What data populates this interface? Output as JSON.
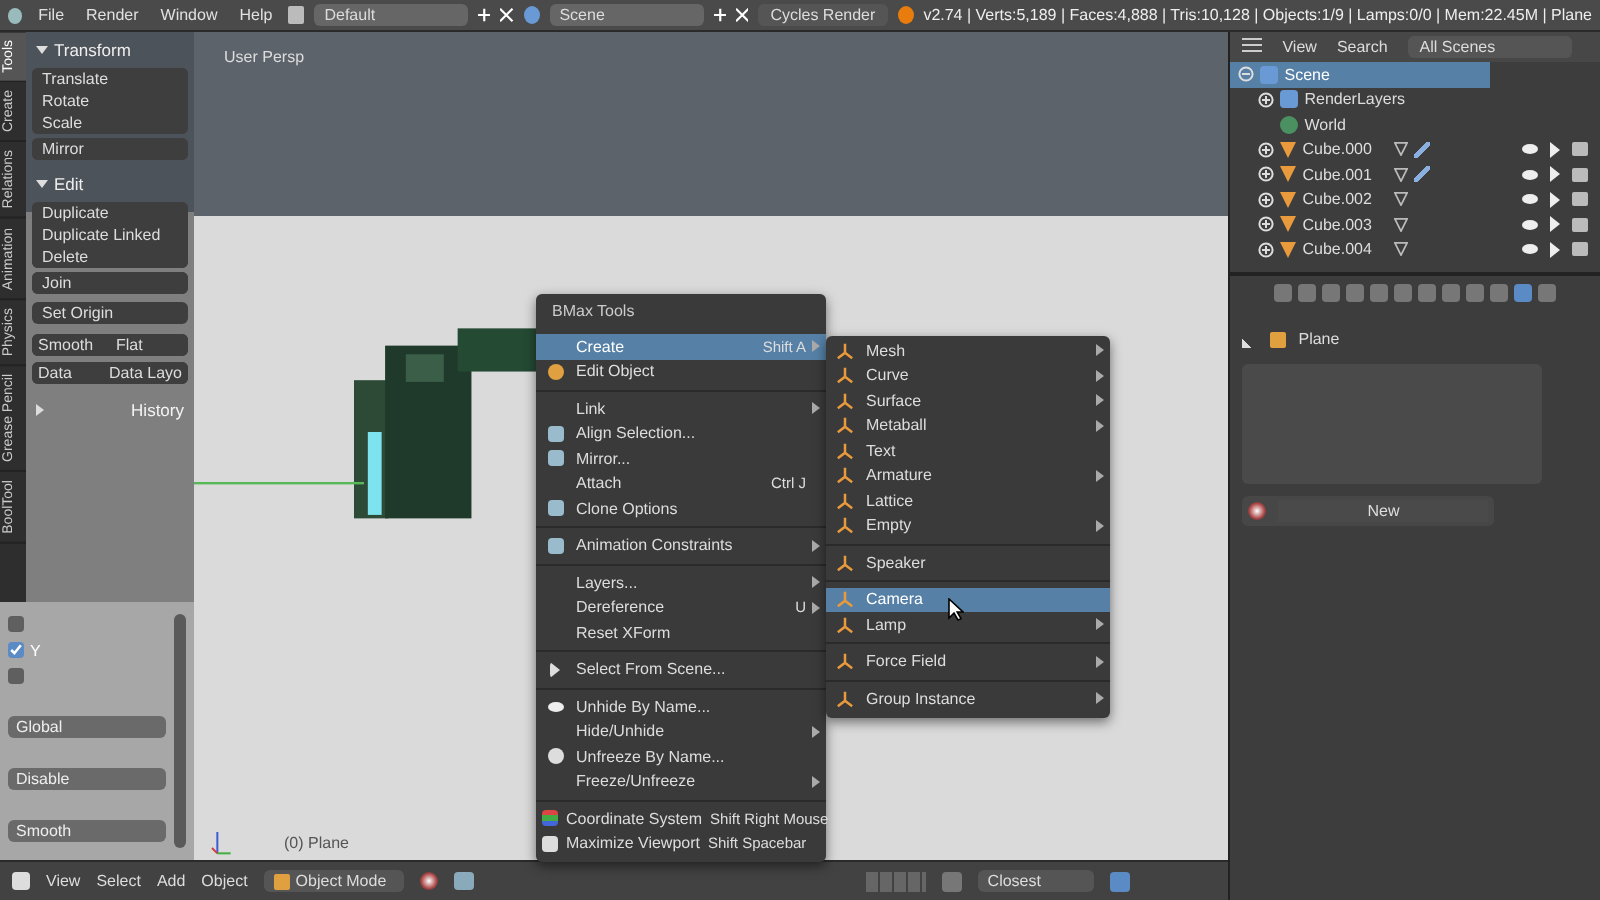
{
  "top_bar": {
    "menus": [
      "File",
      "Render",
      "Window",
      "Help"
    ],
    "screen_layout": "Default",
    "scene": "Scene",
    "render_engine": "Cycles Render",
    "stats": "v2.74 | Verts:5,189 | Faces:4,888 | Tris:10,128 | Objects:1/9 | Lamps:0/0 | Mem:22.45M | Plane"
  },
  "tool_tabs": [
    {
      "label": "Tools",
      "selected": true
    },
    {
      "label": "Create",
      "selected": false
    },
    {
      "label": "Relations",
      "selected": false
    },
    {
      "label": "Animation",
      "selected": false
    },
    {
      "label": "Physics",
      "selected": false
    },
    {
      "label": "Grease Pencil",
      "selected": false
    },
    {
      "label": "BoolTool",
      "selected": false
    }
  ],
  "tool_panels": [
    {
      "title": "Transform",
      "expanded": true,
      "groups": [
        [
          "Translate",
          "Rotate",
          "Scale"
        ],
        [
          "Mirror"
        ]
      ]
    },
    {
      "title": "Edit",
      "expanded": true,
      "groups": [
        [
          "Duplicate",
          "Duplicate Linked",
          "Delete"
        ],
        [
          "Join"
        ]
      ],
      "dropdowns": [
        "Set Origin"
      ],
      "rows": [
        [
          "Smooth",
          "Flat"
        ],
        [
          "Data",
          "Data Layo"
        ]
      ]
    },
    {
      "title": "History",
      "expanded": false
    }
  ],
  "operator_panel": {
    "checkboxes": [
      {
        "checked": false
      },
      {
        "label": "Y",
        "checked": true
      },
      {
        "checked": false
      }
    ],
    "dropdowns": [
      "Global",
      "Disable",
      "Smooth"
    ]
  },
  "viewport": {
    "view_label": "User Persp",
    "object_label": "(0) Plane"
  },
  "context_menu": {
    "title": "BMax Tools",
    "items": [
      {
        "kind": "item",
        "label": "Create",
        "shortcut": "Shift A",
        "submenu": true,
        "selected": true
      },
      {
        "kind": "item",
        "label": "Edit Object",
        "submenu": false,
        "selected": false
      },
      {
        "kind": "separator"
      },
      {
        "kind": "item",
        "label": "Link",
        "submenu": true,
        "selected": false
      },
      {
        "kind": "item",
        "label": "Align Selection...",
        "submenu": false,
        "selected": false
      },
      {
        "kind": "item",
        "label": "Mirror...",
        "submenu": false,
        "selected": false
      },
      {
        "kind": "item",
        "label": "Attach",
        "shortcut": "Ctrl J",
        "submenu": false,
        "selected": false
      },
      {
        "kind": "item",
        "label": "Clone Options",
        "submenu": false,
        "selected": false
      },
      {
        "kind": "separator"
      },
      {
        "kind": "item",
        "label": "Animation Constraints",
        "submenu": true,
        "selected": false
      },
      {
        "kind": "separator"
      },
      {
        "kind": "item",
        "label": "Layers...",
        "submenu": true,
        "selected": false
      },
      {
        "kind": "item",
        "label": "Dereference",
        "shortcut": "U",
        "submenu": true,
        "selected": false
      },
      {
        "kind": "item",
        "label": "Reset XForm",
        "submenu": false,
        "selected": false
      },
      {
        "kind": "separator"
      },
      {
        "kind": "item",
        "label": "Select From Scene...",
        "submenu": false,
        "selected": false
      },
      {
        "kind": "separator"
      },
      {
        "kind": "item",
        "label": "Unhide By Name...",
        "submenu": false,
        "selected": false
      },
      {
        "kind": "item",
        "label": "Hide/Unhide",
        "submenu": true,
        "selected": false
      },
      {
        "kind": "item",
        "label": "Unfreeze By Name...",
        "submenu": false,
        "selected": false
      },
      {
        "kind": "item",
        "label": "Freeze/Unfreeze",
        "submenu": true,
        "selected": false
      },
      {
        "kind": "separator"
      },
      {
        "kind": "item",
        "label": "Coordinate System",
        "shortcut": "Shift Right Mouse",
        "submenu": false,
        "selected": false
      },
      {
        "kind": "item",
        "label": "Maximize Viewport",
        "shortcut": "Shift Spacebar",
        "submenu": false,
        "selected": false
      }
    ]
  },
  "create_submenu": {
    "items": [
      {
        "kind": "item",
        "label": "Mesh",
        "submenu": true,
        "selected": false
      },
      {
        "kind": "item",
        "label": "Curve",
        "submenu": true,
        "selected": false
      },
      {
        "kind": "item",
        "label": "Surface",
        "submenu": true,
        "selected": false
      },
      {
        "kind": "item",
        "label": "Metaball",
        "submenu": true,
        "selected": false
      },
      {
        "kind": "item",
        "label": "Text",
        "submenu": false,
        "selected": false
      },
      {
        "kind": "item",
        "label": "Armature",
        "submenu": true,
        "selected": false
      },
      {
        "kind": "item",
        "label": "Lattice",
        "submenu": false,
        "selected": false
      },
      {
        "kind": "item",
        "label": "Empty",
        "submenu": true,
        "selected": false
      },
      {
        "kind": "separator"
      },
      {
        "kind": "item",
        "label": "Speaker",
        "submenu": false,
        "selected": false
      },
      {
        "kind": "separator"
      },
      {
        "kind": "item",
        "label": "Camera",
        "submenu": false,
        "selected": true
      },
      {
        "kind": "item",
        "label": "Lamp",
        "submenu": true,
        "selected": false
      },
      {
        "kind": "separator"
      },
      {
        "kind": "item",
        "label": "Force Field",
        "submenu": true,
        "selected": false
      },
      {
        "kind": "separator"
      },
      {
        "kind": "item",
        "label": "Group Instance",
        "submenu": true,
        "selected": false
      }
    ]
  },
  "outliner": {
    "header": [
      "View",
      "Search"
    ],
    "scenes_filter": "All Scenes",
    "tree": [
      {
        "label": "Scene",
        "kind": "scene",
        "selected": true,
        "expanded": true,
        "children": [
          {
            "label": "RenderLayers",
            "kind": "layers",
            "selected": false,
            "expanded": false
          },
          {
            "label": "World",
            "kind": "world",
            "selected": false
          },
          {
            "label": "Cube.000",
            "kind": "object",
            "selected": false,
            "expanded": false,
            "modifier": true
          },
          {
            "label": "Cube.001",
            "kind": "object",
            "selected": false,
            "expanded": false,
            "modifier": true
          },
          {
            "label": "Cube.002",
            "kind": "object",
            "selected": false,
            "expanded": false,
            "modifier": false
          },
          {
            "label": "Cube.003",
            "kind": "object",
            "selected": false,
            "expanded": false,
            "modifier": false
          },
          {
            "label": "Cube.004",
            "kind": "object",
            "selected": false,
            "expanded": false,
            "modifier": false
          }
        ]
      }
    ]
  },
  "properties": {
    "object_name": "Plane",
    "new_button": "New"
  },
  "bottom_bar": {
    "menus": [
      "View",
      "Select",
      "Add",
      "Object"
    ],
    "mode": "Object Mode",
    "snap_target": "Closest"
  }
}
